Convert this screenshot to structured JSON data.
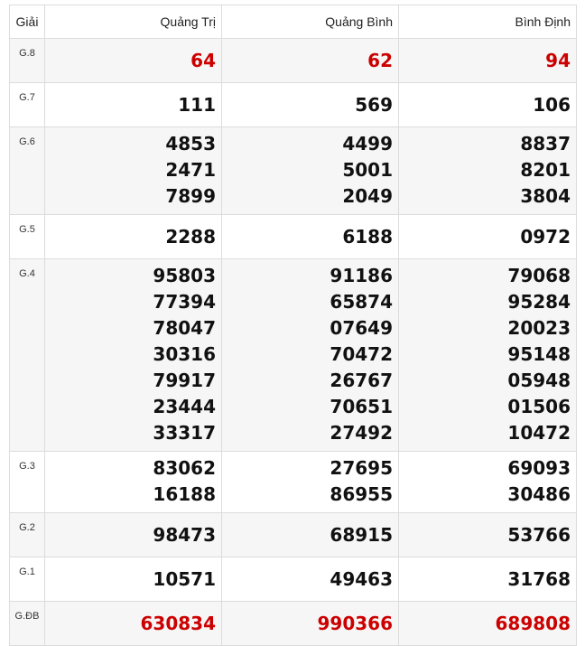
{
  "header": {
    "giai": "Giải",
    "provinces": [
      "Quảng Trị",
      "Quảng Bình",
      "Bình Định"
    ]
  },
  "prizes": {
    "g8": {
      "label": "G.8",
      "values": [
        [
          "64"
        ],
        [
          "62"
        ],
        [
          "94"
        ]
      ]
    },
    "g7": {
      "label": "G.7",
      "values": [
        [
          "111"
        ],
        [
          "569"
        ],
        [
          "106"
        ]
      ]
    },
    "g6": {
      "label": "G.6",
      "values": [
        [
          "4853",
          "2471",
          "7899"
        ],
        [
          "4499",
          "5001",
          "2049"
        ],
        [
          "8837",
          "8201",
          "3804"
        ]
      ]
    },
    "g5": {
      "label": "G.5",
      "values": [
        [
          "2288"
        ],
        [
          "6188"
        ],
        [
          "0972"
        ]
      ]
    },
    "g4": {
      "label": "G.4",
      "values": [
        [
          "95803",
          "77394",
          "78047",
          "30316",
          "79917",
          "23444",
          "33317"
        ],
        [
          "91186",
          "65874",
          "07649",
          "70472",
          "26767",
          "70651",
          "27492"
        ],
        [
          "79068",
          "95284",
          "20023",
          "95148",
          "05948",
          "01506",
          "10472"
        ]
      ]
    },
    "g3": {
      "label": "G.3",
      "values": [
        [
          "83062",
          "16188"
        ],
        [
          "27695",
          "86955"
        ],
        [
          "69093",
          "30486"
        ]
      ]
    },
    "g2": {
      "label": "G.2",
      "values": [
        [
          "98473"
        ],
        [
          "68915"
        ],
        [
          "53766"
        ]
      ]
    },
    "g1": {
      "label": "G.1",
      "values": [
        [
          "10571"
        ],
        [
          "49463"
        ],
        [
          "31768"
        ]
      ]
    },
    "gdb": {
      "label": "G.ĐB",
      "values": [
        [
          "630834"
        ],
        [
          "990366"
        ],
        [
          "689808"
        ]
      ]
    }
  },
  "colors": {
    "highlight": "#cc0000",
    "text": "#111111",
    "row_alt": "#f6f6f6",
    "border": "#dcdcdc"
  }
}
